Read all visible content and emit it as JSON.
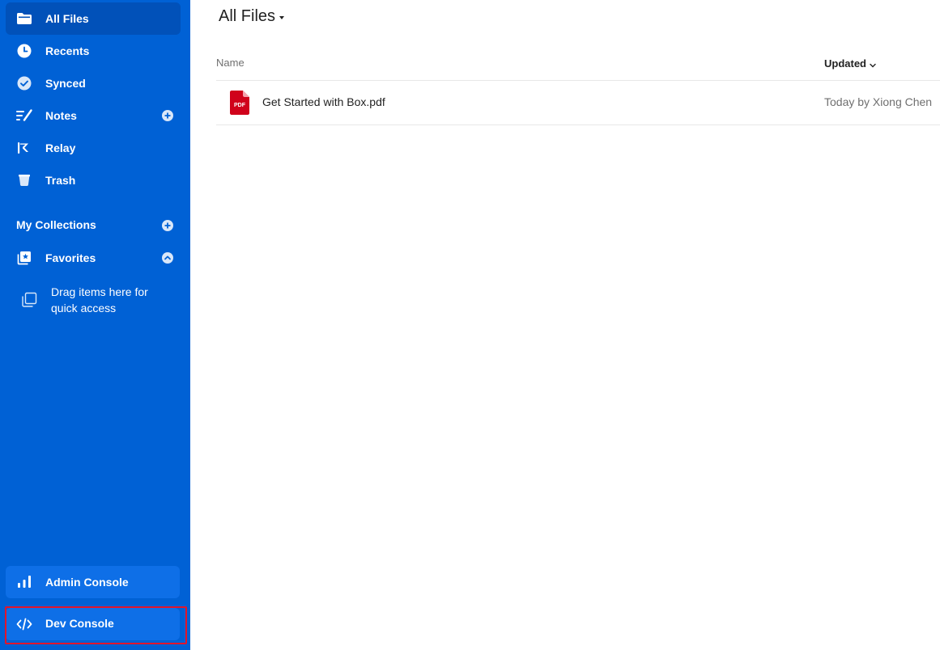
{
  "sidebar": {
    "nav": [
      {
        "label": "All Files",
        "icon": "folder-icon",
        "active": true
      },
      {
        "label": "Recents",
        "icon": "clock-icon"
      },
      {
        "label": "Synced",
        "icon": "check-circle-icon"
      },
      {
        "label": "Notes",
        "icon": "notes-icon"
      },
      {
        "label": "Relay",
        "icon": "relay-icon"
      },
      {
        "label": "Trash",
        "icon": "trash-icon"
      }
    ],
    "collections_title": "My Collections",
    "favorites_label": "Favorites",
    "drag_hint": "Drag items here for quick access",
    "admin_console_label": "Admin Console",
    "dev_console_label": "Dev Console"
  },
  "main": {
    "title": "All Files",
    "columns": {
      "name": "Name",
      "updated": "Updated"
    },
    "files": [
      {
        "name": "Get Started with Box.pdf",
        "updated": "Today by Xiong Chen",
        "type_badge": "PDF"
      }
    ]
  },
  "colors": {
    "sidebar_bg": "#0061d5",
    "sidebar_active": "#0151b9",
    "highlight_border": "#e3152b",
    "pdf_red": "#d0021b"
  }
}
